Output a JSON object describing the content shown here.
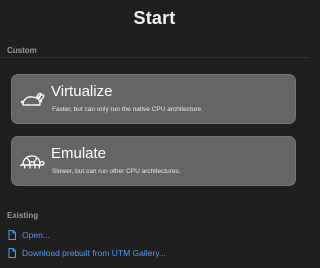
{
  "window": {
    "title": "Start"
  },
  "sections": {
    "custom_label": "Custom",
    "existing_label": "Existing"
  },
  "options": [
    {
      "title": "Virtualize",
      "subtitle": "Faster, but can only run the native CPU architecture.",
      "icon": "rabbit-icon"
    },
    {
      "title": "Emulate",
      "subtitle": "Slower, but can run other CPU architectures.",
      "icon": "turtle-icon"
    }
  ],
  "existing_links": [
    {
      "label": "Open...",
      "icon": "document-icon"
    },
    {
      "label": "Download prebuilt from UTM Gallery...",
      "icon": "document-icon"
    }
  ],
  "colors": {
    "background": "#1f1f1f",
    "card": "#656565",
    "link": "#4f9bf2",
    "section_label": "#9a9a9a"
  }
}
